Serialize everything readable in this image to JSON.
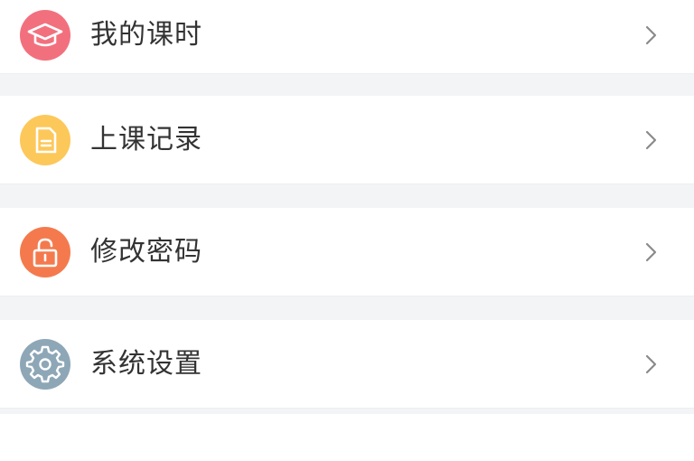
{
  "menu": {
    "items": [
      {
        "label": "我的课时",
        "icon": "graduation-cap-icon",
        "color": "#f2707e"
      },
      {
        "label": "上课记录",
        "icon": "document-icon",
        "color": "#fdc85a"
      },
      {
        "label": "修改密码",
        "icon": "lock-icon",
        "color": "#f47a4e"
      },
      {
        "label": "系统设置",
        "icon": "gear-icon",
        "color": "#8ea7b7"
      }
    ],
    "chevron_icon": "chevron-right-icon"
  }
}
